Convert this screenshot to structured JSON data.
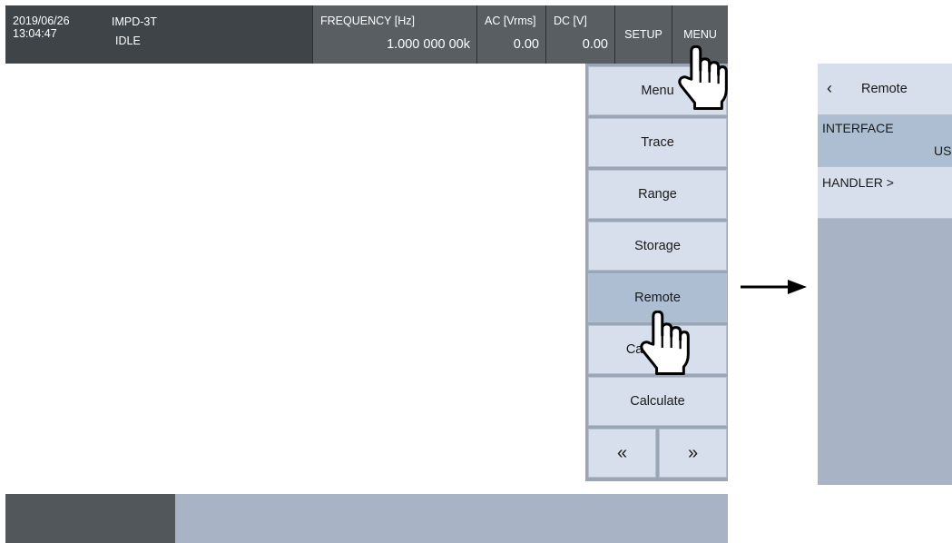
{
  "status": {
    "date": "2019/06/26",
    "time": "13:04:47",
    "mode": "IMPD-3T",
    "state": "IDLE"
  },
  "measurements": {
    "frequency_label": "FREQUENCY [Hz]",
    "frequency_value": "1.000 000 00k",
    "ac_label": "AC [Vrms]",
    "ac_value": "0.00",
    "dc_label": "DC [V]",
    "dc_value": "0.00"
  },
  "topbar_buttons": {
    "setup": "SETUP",
    "menu": "MENU"
  },
  "menu": {
    "items": [
      {
        "label": "Menu"
      },
      {
        "label": "Trace"
      },
      {
        "label": "Range"
      },
      {
        "label": "Storage"
      },
      {
        "label": "Remote",
        "selected": true
      },
      {
        "label": "Calibration"
      },
      {
        "label": "Calculate"
      }
    ],
    "prev": "«",
    "next": "»"
  },
  "remote_panel": {
    "back_icon": "‹",
    "title": "Remote",
    "interface_label": "INTERFACE",
    "interface_value": "USB",
    "handler_label": "HANDLER >"
  },
  "icons": {
    "cursor": "hand-pointer-icon",
    "arrow": "arrow-right-icon"
  },
  "colors": {
    "topbar": "#3f4448",
    "button": "#d6dfeb",
    "selected": "#aebed2",
    "panel_bg": "#a8b3c5"
  }
}
